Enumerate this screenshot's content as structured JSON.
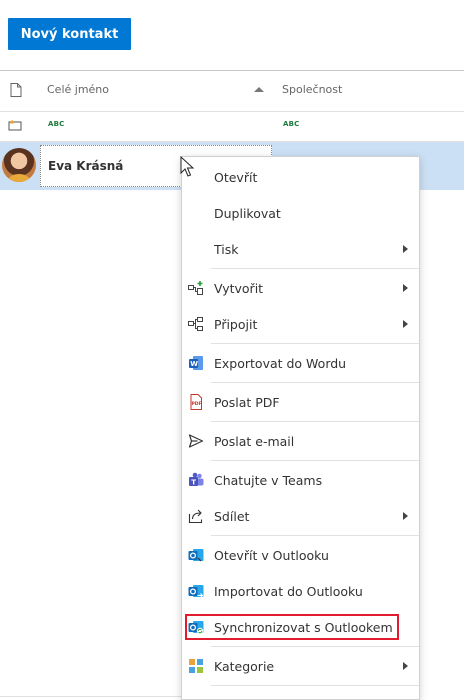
{
  "toolbar": {
    "new_contact_label": "Nový kontakt"
  },
  "grid": {
    "columns": [
      {
        "label": ""
      },
      {
        "label": "Celé jméno"
      },
      {
        "label": "Společnost"
      }
    ],
    "filter": {
      "abc_label": "ABC"
    },
    "rows": [
      {
        "full_name": "Eva Krásná",
        "company": ""
      }
    ]
  },
  "context_menu": {
    "items": [
      {
        "label": "Otevřít",
        "icon": "none",
        "submenu": false
      },
      {
        "label": "Duplikovat",
        "icon": "none",
        "submenu": false
      },
      {
        "label": "Tisk",
        "icon": "none",
        "submenu": true
      },
      {
        "label": "Vytvořit",
        "icon": "create-icon",
        "submenu": true
      },
      {
        "label": "Připojit",
        "icon": "attach-icon",
        "submenu": true
      },
      {
        "label": "Exportovat do Wordu",
        "icon": "word-icon",
        "submenu": false
      },
      {
        "label": "Poslat PDF",
        "icon": "pdf-icon",
        "submenu": false
      },
      {
        "label": "Poslat e-mail",
        "icon": "send-icon",
        "submenu": false
      },
      {
        "label": "Chatujte v Teams",
        "icon": "teams-icon",
        "submenu": false
      },
      {
        "label": "Sdílet",
        "icon": "share-icon",
        "submenu": true
      },
      {
        "label": "Otevřít v Outlooku",
        "icon": "outlook-icon",
        "submenu": false
      },
      {
        "label": "Importovat do Outlooku",
        "icon": "outlook-import-icon",
        "submenu": false
      },
      {
        "label": "Synchronizovat s Outlookem",
        "icon": "outlook-sync-icon",
        "submenu": false,
        "highlighted": true
      },
      {
        "label": "Kategorie",
        "icon": "category-icon",
        "submenu": true
      }
    ]
  },
  "colors": {
    "accent": "#0078d4",
    "selected_row": "#cce0f5",
    "highlight_border": "#e21b2e"
  }
}
